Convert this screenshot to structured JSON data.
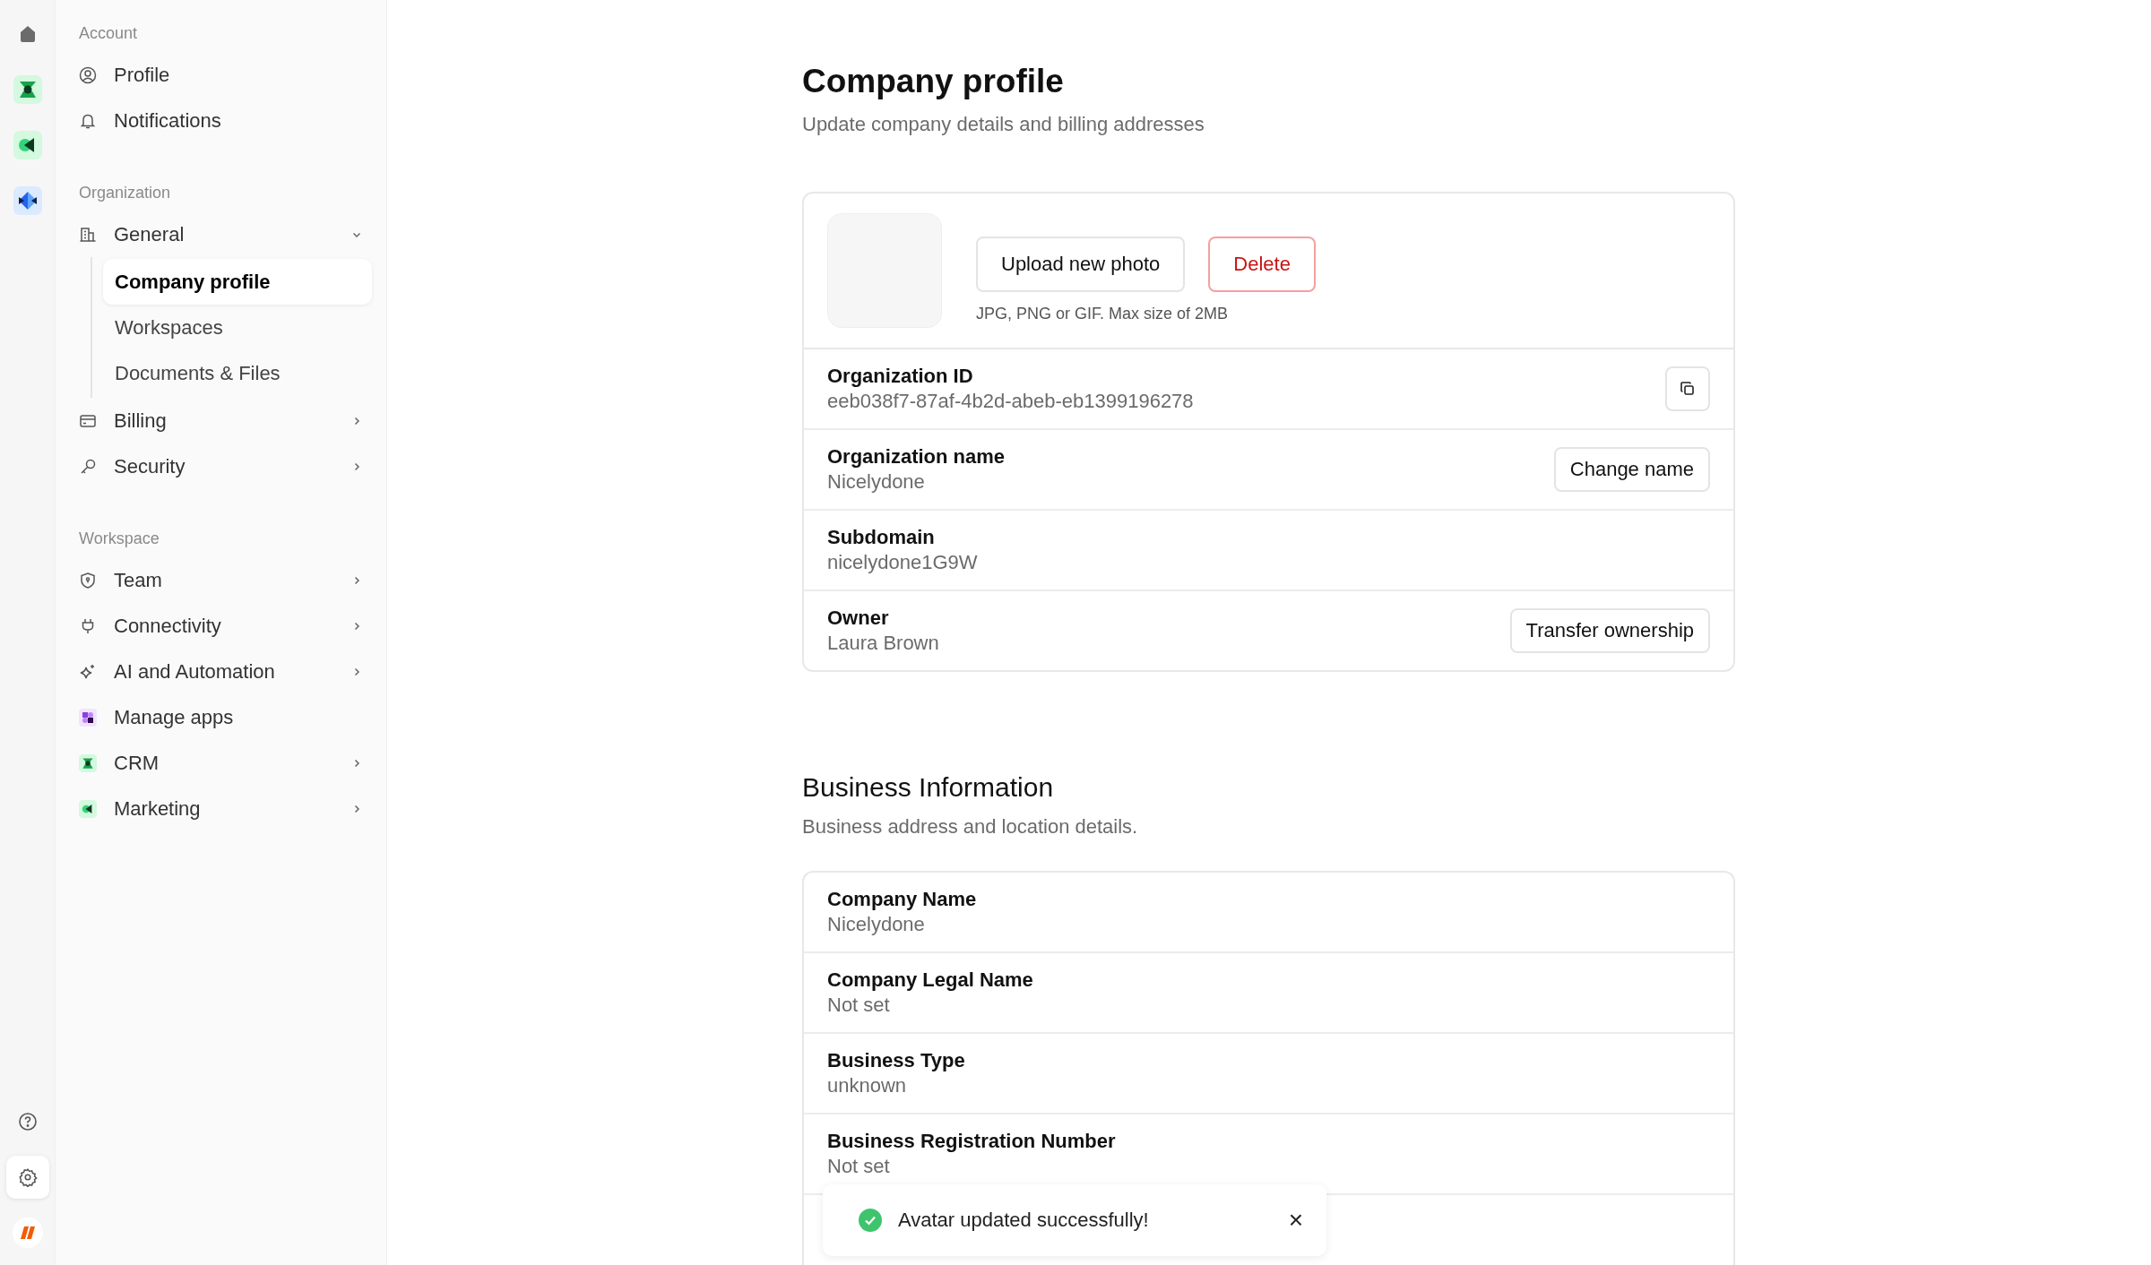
{
  "rail": {
    "top": [
      {
        "selected": false
      },
      {
        "selected": false
      },
      {
        "selected": false
      },
      {
        "selected": false
      }
    ],
    "bottom": [
      {
        "selected": false
      },
      {
        "selected": true
      },
      {
        "selected": false
      }
    ]
  },
  "sidebar": {
    "sections": [
      {
        "title": "Account",
        "items": [
          {
            "label": "Profile",
            "kind": "link",
            "selected": false
          },
          {
            "label": "Notifications",
            "kind": "link",
            "selected": false
          }
        ]
      },
      {
        "title": "Organization",
        "items": [
          {
            "label": "General",
            "kind": "group",
            "expanded": true,
            "selected": false,
            "children": [
              {
                "label": "Company profile",
                "selected": true
              },
              {
                "label": "Workspaces",
                "selected": false
              },
              {
                "label": "Documents & Files",
                "selected": false
              }
            ]
          },
          {
            "label": "Billing",
            "kind": "group",
            "expanded": false,
            "selected": false
          },
          {
            "label": "Security",
            "kind": "group",
            "expanded": false,
            "selected": false
          }
        ]
      },
      {
        "title": "Workspace",
        "items": [
          {
            "label": "Team",
            "kind": "group",
            "expanded": false,
            "selected": false
          },
          {
            "label": "Connectivity",
            "kind": "group",
            "expanded": false,
            "selected": false
          },
          {
            "label": "AI and Automation",
            "kind": "group",
            "expanded": false,
            "selected": false
          },
          {
            "label": "Manage apps",
            "kind": "link",
            "selected": false
          },
          {
            "label": "CRM",
            "kind": "group",
            "expanded": false,
            "selected": false
          },
          {
            "label": "Marketing",
            "kind": "group",
            "expanded": false,
            "selected": false
          }
        ]
      }
    ]
  },
  "page": {
    "title": "Company profile",
    "subtitle": "Update company details and billing addresses"
  },
  "photo": {
    "upload": "Upload new photo",
    "delete": "Delete",
    "hint": "JPG, PNG or GIF. Max size of 2MB"
  },
  "company_rows": [
    {
      "label": "Organization ID",
      "value": "eeb038f7-87af-4b2d-abeb-eb1399196278",
      "action": {
        "kind": "copy"
      }
    },
    {
      "label": "Organization name",
      "value": "Nicelydone",
      "action": {
        "kind": "text",
        "label": "Change name"
      }
    },
    {
      "label": "Subdomain",
      "value": "nicelydone1G9W"
    },
    {
      "label": "Owner",
      "value": "Laura Brown",
      "action": {
        "kind": "text",
        "label": "Transfer ownership"
      }
    }
  ],
  "business": {
    "title": "Business Information",
    "subtitle": "Business address and location details.",
    "rows": [
      {
        "label": "Company Name",
        "value": "Nicelydone"
      },
      {
        "label": "Company Legal Name",
        "value": "Not set"
      },
      {
        "label": "Business Type",
        "value": "unknown"
      },
      {
        "label": "Business Registration Number",
        "value": "Not set"
      }
    ]
  },
  "toast": {
    "message": "Avatar updated successfully!",
    "close": "×"
  }
}
